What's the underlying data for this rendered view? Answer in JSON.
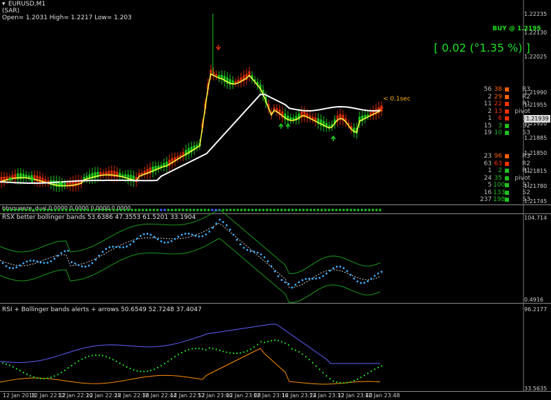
{
  "chart": {
    "symbol_title": "EURUSD,M1",
    "subtitle": "(SAR)",
    "ohlc_text": "Open= 1.2031 High= 1.2217 Low= 1.203",
    "buy_label": "BUY @ 1.2195",
    "profit_text": "[ 0.02  (°1.35 %) ]",
    "timer_text": "< 0.1sec",
    "current_price": "1.21939",
    "price_axis": [
      "1.22235",
      "1.22130",
      "1.22025",
      "1.21990",
      "1.21955",
      "1.21920",
      "1.21885",
      "1.21850",
      "1.21815",
      "1.21780",
      "1.21745"
    ]
  },
  "pivots_top": [
    {
      "a": "56",
      "b": "38",
      "label": "R3",
      "bcolor": "#ff6000"
    },
    {
      "a": "2",
      "b": "29",
      "label": "R2",
      "bcolor": "#ff6000"
    },
    {
      "a": "11",
      "b": "22",
      "label": "R1",
      "bcolor": "#ff3000"
    },
    {
      "a": "2",
      "b": "13",
      "label": "pivot",
      "bcolor": "#ff3000"
    },
    {
      "a": "1",
      "b": "6",
      "label": "S1",
      "bcolor": "#ff3000"
    },
    {
      "a": "15",
      "b": "3",
      "label": "S2",
      "bcolor": "#20c020"
    },
    {
      "a": "19",
      "b": "10",
      "label": "S3",
      "bcolor": "#20c020"
    }
  ],
  "pivots_bottom": [
    {
      "a": "23",
      "b": "96",
      "label": "R3",
      "bcolor": "#ff6000"
    },
    {
      "a": "63",
      "b": "63",
      "label": "R2",
      "bcolor": "#ff3000"
    },
    {
      "a": "1",
      "b": "2",
      "label": "R1",
      "bcolor": "#20c020"
    },
    {
      "a": "24",
      "b": "35",
      "label": "pivot",
      "bcolor": "#20c020"
    },
    {
      "a": "5",
      "b": "100",
      "label": "S1",
      "bcolor": "#20c020"
    },
    {
      "a": "16",
      "b": "133",
      "label": "S2",
      "bcolor": "#20c020"
    },
    {
      "a": "237",
      "b": "198",
      "label": "S3",
      "bcolor": "#20c020"
    }
  ],
  "indicators": {
    "bbsqueeze_label": "bbsqueeze_dual 0.0000 0.0000 0.0000 0.0000",
    "rsx_label": "RSX better bollinger bands  53.6386 47.3553 61.5201 33.1904",
    "rsx_axis_top": "104.714",
    "rsx_axis_bottom": "0.4916",
    "rsi_label": "RSI + Bollinger bands alerts + arrows 50.6549 52.7248 37.4047",
    "rsi_axis_top": "96.2177",
    "rsi_axis_bottom": "33.5635"
  },
  "time_axis": [
    "12 Jan 2018",
    "12 Jan 22:12",
    "12 Jan 22:20",
    "12 Jan 22:28",
    "12 Jan 22:36",
    "12 Jan 22:44",
    "12 Jan 22:52",
    "12 Jan 23:00",
    "12 Jan 23:08",
    "12 Jan 23:16",
    "12 Jan 23:24",
    "12 Jan 23:32",
    "12 Jan 23:40",
    "12 Jan 23:48"
  ],
  "colors": {
    "bull": "#20d020",
    "bear": "#e03000",
    "white_line": "#ffffff",
    "yellow_line": "#ffff40",
    "band": "#1a9a1a",
    "rsx_dots": "#40b0ff",
    "rsi_upper": "#6060ff",
    "rsi_lower": "#ff9000"
  }
}
